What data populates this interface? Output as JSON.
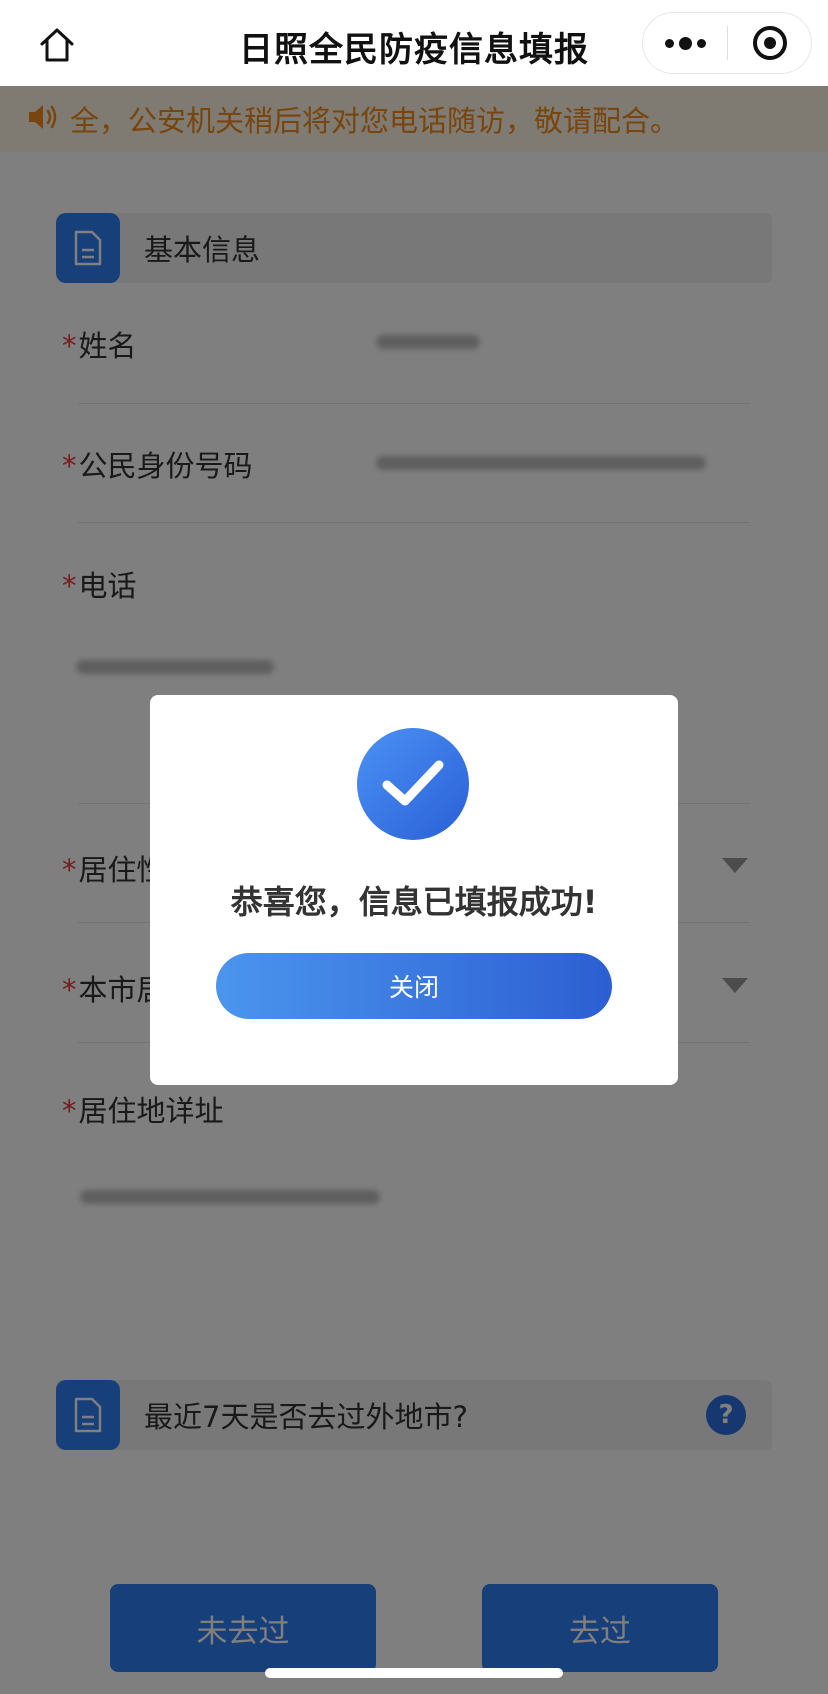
{
  "nav": {
    "title": "日照全民防疫信息填报",
    "home_icon": "home-icon",
    "more_icon": "more-dots-icon",
    "close_icon": "target-close-icon"
  },
  "notice": {
    "icon": "speaker-icon",
    "text": "全，公安机关稍后将对您电话随访，敬请配合。"
  },
  "basic_info": {
    "title": "基本信息",
    "icon": "document-icon",
    "required_mark": "*",
    "fields": [
      {
        "label": "姓名"
      },
      {
        "label": "公民身份号码"
      },
      {
        "label": "电话"
      },
      {
        "label": "居住性"
      },
      {
        "label": "本市居"
      },
      {
        "label": "居住地详址"
      }
    ]
  },
  "travel": {
    "question": "最近7天是否去过外地市?",
    "icon": "document-icon",
    "help_icon": "question-icon",
    "help_glyph": "?",
    "options": [
      "未去过",
      "去过"
    ]
  },
  "dialog": {
    "icon": "check-circle-icon",
    "message": "恭喜您，信息已填报成功!",
    "close_label": "关闭"
  },
  "colors": {
    "accent": "#2f7ef3",
    "notice_text": "#f08b1e",
    "required": "#e83b3b"
  }
}
